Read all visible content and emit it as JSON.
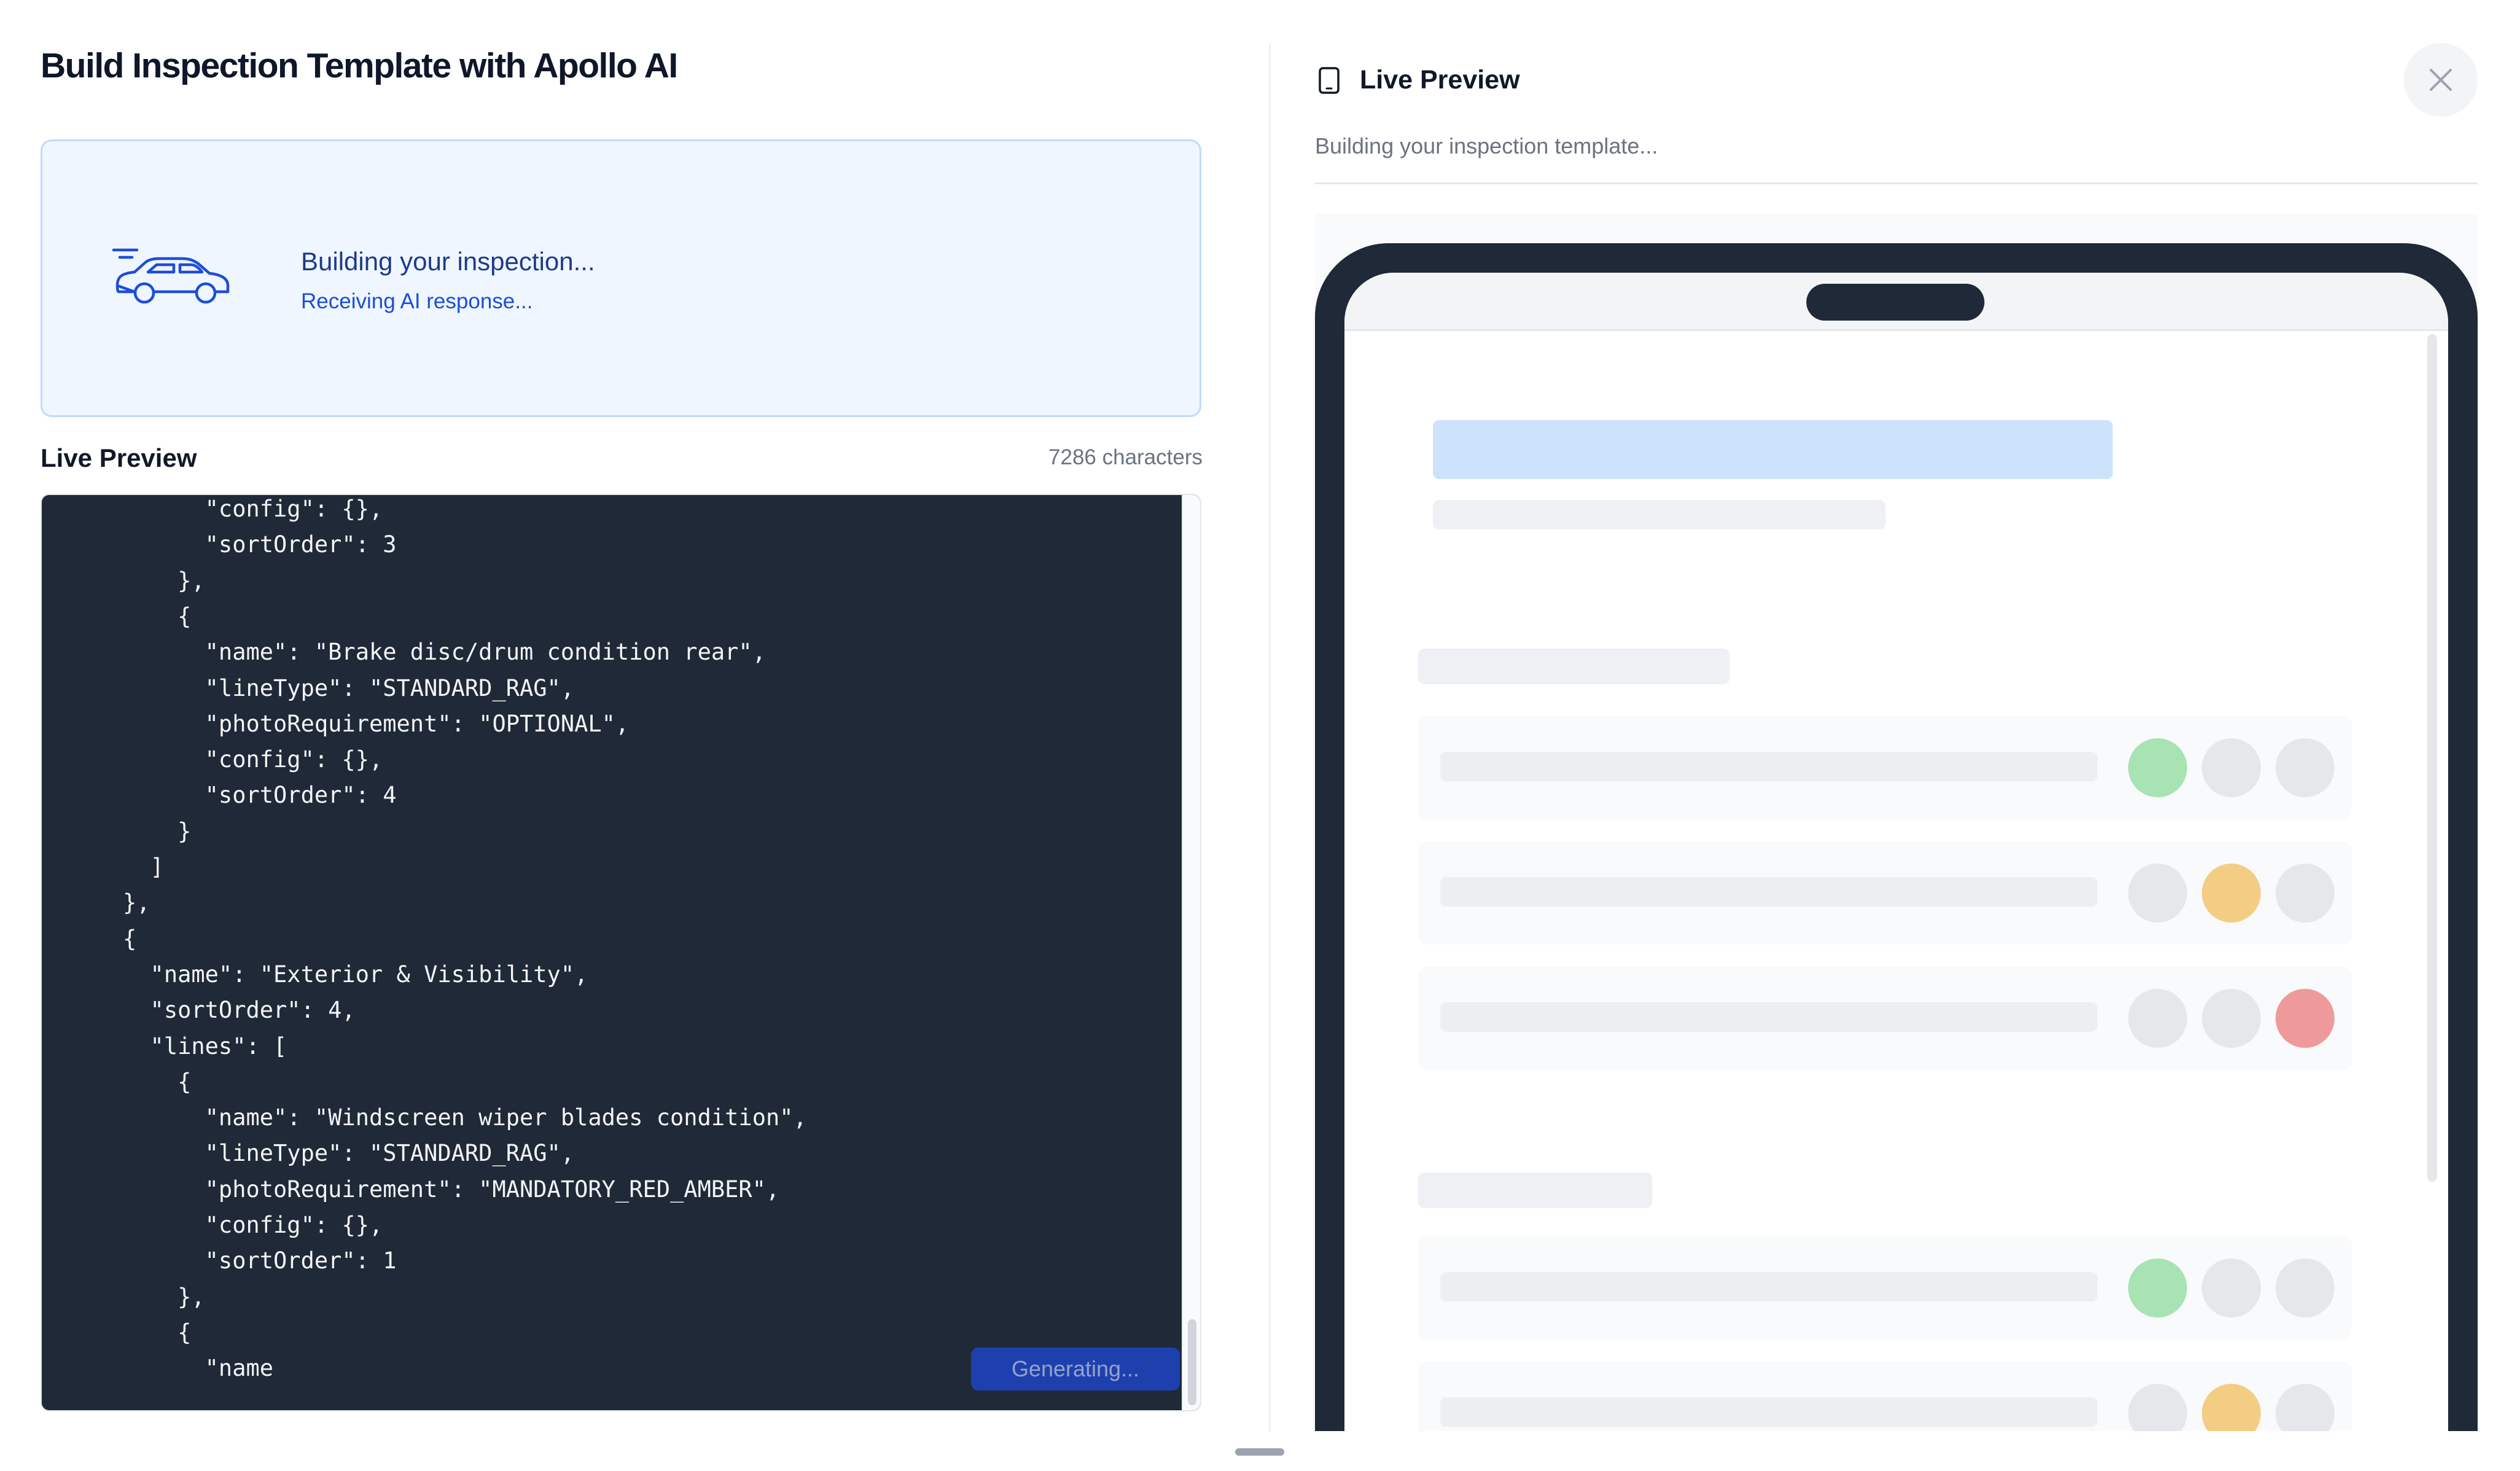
{
  "page": {
    "title": "Build Inspection Template with Apollo AI"
  },
  "status_card": {
    "title": "Building your inspection...",
    "subtitle": "Receiving AI response..."
  },
  "code_preview": {
    "label": "Live Preview",
    "char_count": "7286 characters",
    "lines": [
      "      \"config\": {},",
      "      \"sortOrder\": 3",
      "    },",
      "    {",
      "      \"name\": \"Brake disc/drum condition rear\",",
      "      \"lineType\": \"STANDARD_RAG\",",
      "      \"photoRequirement\": \"OPTIONAL\",",
      "      \"config\": {},",
      "      \"sortOrder\": 4",
      "    }",
      "  ]",
      "},",
      "{",
      "  \"name\": \"Exterior & Visibility\",",
      "  \"sortOrder\": 4,",
      "  \"lines\": [",
      "    {",
      "      \"name\": \"Windscreen wiper blades condition\",",
      "      \"lineType\": \"STANDARD_RAG\",",
      "      \"photoRequirement\": \"MANDATORY_RED_AMBER\",",
      "      \"config\": {},",
      "      \"sortOrder\": 1",
      "    },",
      "    {",
      "      \"name"
    ],
    "generate_button": "Generating..."
  },
  "live_preview": {
    "title": "Live Preview",
    "subtitle": "Building your inspection template...",
    "icon": "tablet-icon",
    "close_icon": "close-icon",
    "rows": [
      {
        "rag": "green"
      },
      {
        "rag": "amber"
      },
      {
        "rag": "red"
      },
      {
        "rag": "green"
      },
      {
        "rag": "amber"
      }
    ]
  },
  "colors": {
    "green": "#a7e3b3",
    "amber": "#f4cd85",
    "red": "#ef9a9a",
    "accent": "#1e40af"
  }
}
